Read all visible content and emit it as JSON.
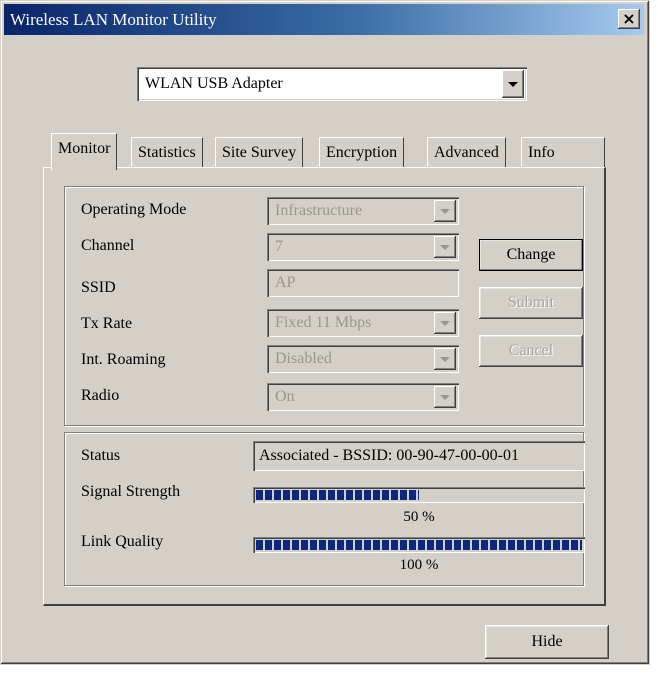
{
  "window": {
    "title": "Wireless LAN Monitor Utility",
    "close_symbol": "×"
  },
  "adapter": {
    "selected": "WLAN USB Adapter"
  },
  "tabs": [
    {
      "label": "Monitor",
      "active": true
    },
    {
      "label": "Statistics",
      "active": false
    },
    {
      "label": "Site Survey",
      "active": false
    },
    {
      "label": "Encryption",
      "active": false
    },
    {
      "label": "Advanced",
      "active": false
    },
    {
      "label": "Info",
      "active": false
    }
  ],
  "settings": {
    "operating_mode": {
      "label": "Operating Mode",
      "value": "Infrastructure"
    },
    "channel": {
      "label": "Channel",
      "value": "7"
    },
    "ssid": {
      "label": "SSID",
      "value": "AP"
    },
    "tx_rate": {
      "label": "Tx Rate",
      "value": "Fixed 11 Mbps"
    },
    "int_roaming": {
      "label": "Int. Roaming",
      "value": "Disabled"
    },
    "radio": {
      "label": "Radio",
      "value": "On"
    }
  },
  "buttons": {
    "change": "Change",
    "submit": "Submit",
    "cancel": "Cancel",
    "hide": "Hide"
  },
  "status": {
    "status_label": "Status",
    "status_value": "Associated - BSSID: 00-90-47-00-00-01",
    "signal_label": "Signal Strength",
    "signal_percent": 50,
    "signal_text": "50 %",
    "link_label": "Link Quality",
    "link_percent": 100,
    "link_text": "100 %"
  }
}
